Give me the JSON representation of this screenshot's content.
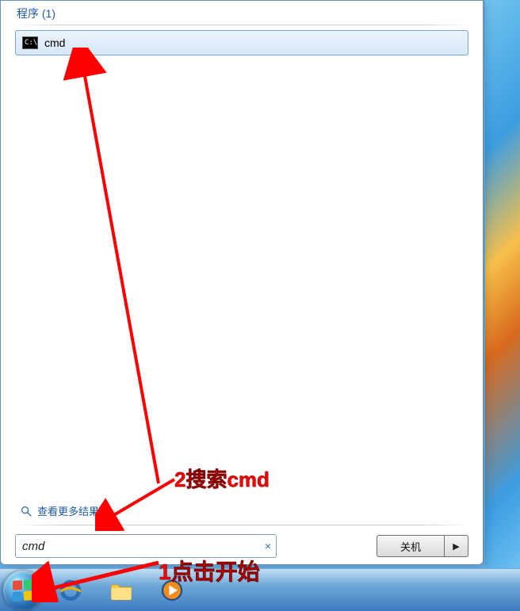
{
  "section_header": "程序 (1)",
  "result": {
    "label": "cmd",
    "icon": "cmd-icon"
  },
  "more_results": "查看更多结果",
  "search": {
    "value": "cmd",
    "clear": "×"
  },
  "shutdown": {
    "label": "关机",
    "arrow": "▶"
  },
  "taskbar": {
    "items": [
      "start-orb",
      "ie-icon",
      "folder-icon",
      "wmp-icon"
    ]
  },
  "annotations": {
    "step1": "1点击开始",
    "step2": "2搜索cmd"
  }
}
